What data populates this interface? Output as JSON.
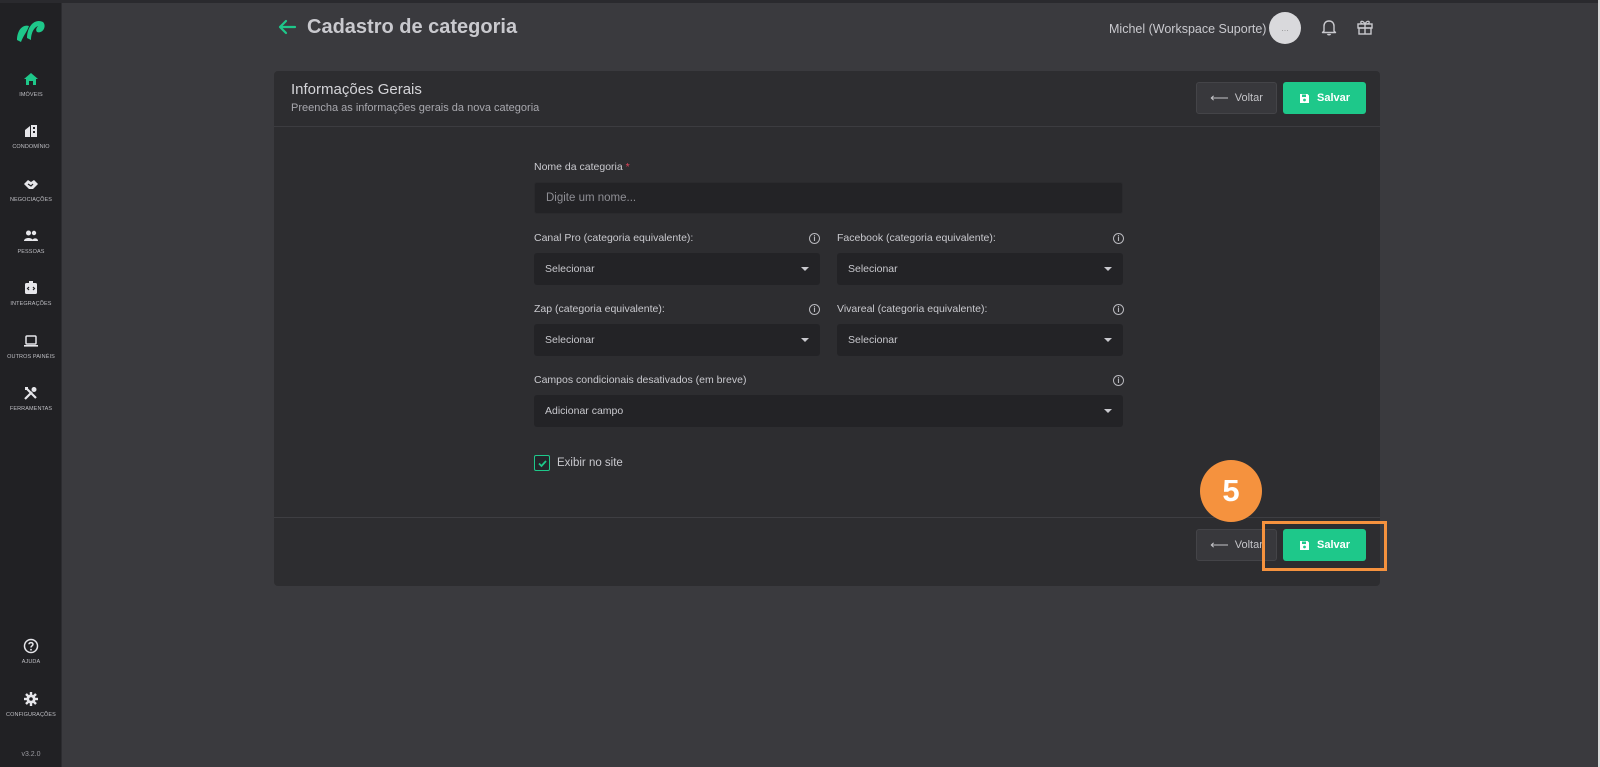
{
  "header": {
    "title": "Cadastro de categoria",
    "user_name": "Michel (Workspace Suporte)",
    "avatar_text": "..."
  },
  "sidebar": {
    "items": [
      {
        "label": "IMÓVEIS",
        "icon": "home-icon"
      },
      {
        "label": "CONDOMÍNIO",
        "icon": "building-icon"
      },
      {
        "label": "NEGOCIAÇÕES",
        "icon": "handshake-icon"
      },
      {
        "label": "PESSOAS",
        "icon": "people-icon"
      },
      {
        "label": "INTEGRAÇÕES",
        "icon": "integrations-icon"
      },
      {
        "label": "OUTROS PAINÉIS",
        "icon": "laptop-icon"
      },
      {
        "label": "FERRAMENTAS",
        "icon": "tools-icon"
      }
    ],
    "help_label": "AJUDA",
    "settings_label": "CONFIGURAÇÕES",
    "version": "v3.2.0"
  },
  "card": {
    "title": "Informações Gerais",
    "subtitle": "Preencha as informações gerais da nova categoria",
    "voltar_label": "Voltar",
    "salvar_label": "Salvar"
  },
  "form": {
    "name_label": "Nome da categoria",
    "required_mark": "*",
    "name_placeholder": "Digite um nome...",
    "canal_pro_label": "Canal Pro (categoria equivalente):",
    "facebook_label": "Facebook (categoria equivalente):",
    "zap_label": "Zap (categoria equivalente):",
    "vivareal_label": "Vivareal (categoria equivalente):",
    "select_value": "Selecionar",
    "conditional_label": "Campos condicionais desativados (em breve)",
    "add_field_label": "Adicionar campo",
    "show_on_site_label": "Exibir no site",
    "show_on_site_checked": true
  },
  "footer": {
    "voltar_label": "Voltar",
    "salvar_label": "Salvar"
  },
  "callout": {
    "step": "5"
  },
  "colors": {
    "accent": "#1ec88a",
    "callout": "#f5923e",
    "background": "#3a3a3e",
    "sidebar": "#212124",
    "card": "#2d2d30"
  }
}
